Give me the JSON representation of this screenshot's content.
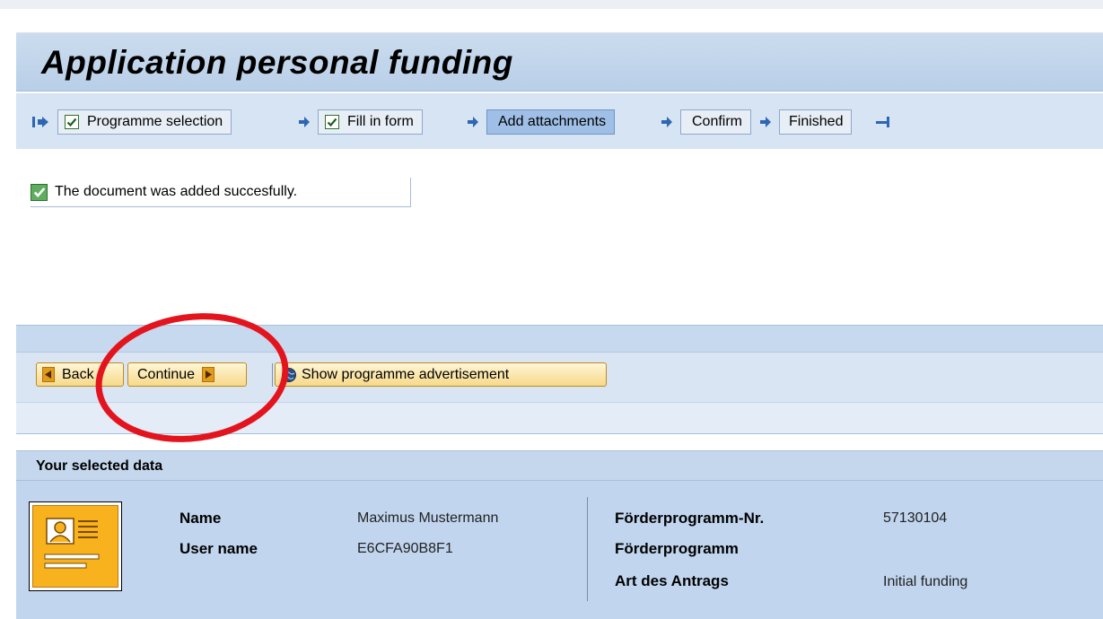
{
  "page": {
    "title": "Application personal funding"
  },
  "roadmap": {
    "steps": [
      {
        "label": "Programme selection",
        "done": true,
        "active": false
      },
      {
        "label": "Fill in form",
        "done": true,
        "active": false
      },
      {
        "label": "Add attachments",
        "done": false,
        "active": true
      },
      {
        "label": "Confirm",
        "done": false,
        "active": false
      },
      {
        "label": "Finished",
        "done": false,
        "active": false
      }
    ]
  },
  "message": {
    "text": "The document was added succesfully.",
    "type": "success"
  },
  "toolbar": {
    "back_label": "Back",
    "continue_label": "Continue",
    "show_ad_label": "Show programme advertisement"
  },
  "data_section": {
    "header": "Your selected data",
    "left": [
      {
        "label": "Name",
        "value": "Maximus Mustermann"
      },
      {
        "label": "User name",
        "value": "E6CFA90B8F1"
      }
    ],
    "right": [
      {
        "label": "Förderprogramm-Nr.",
        "value": "57130104"
      },
      {
        "label": "Förderprogramm",
        "value": ""
      },
      {
        "label": "Art des Antrags",
        "value": "Initial funding"
      }
    ]
  },
  "icons": {
    "roadmap_start": "roadmap-start-icon",
    "roadmap_arrow": "arrow-right-icon",
    "roadmap_end": "roadmap-end-icon",
    "check": "check-icon",
    "back": "triangle-left-icon",
    "continue": "triangle-right-icon",
    "globe": "globe-icon",
    "avatar": "user-card-icon"
  },
  "colors": {
    "accent_blue": "#c1d5ee",
    "button_gold": "#f6d98a",
    "success_green": "#5fae5f",
    "callout_red": "#e3141d"
  }
}
